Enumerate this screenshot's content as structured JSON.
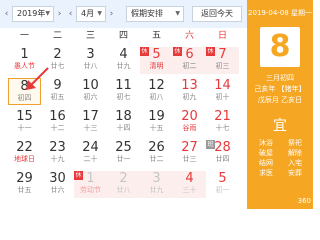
{
  "toolbar": {
    "year_value": "2019年",
    "month_value": "4月",
    "holiday_select": "假期安排",
    "today_button": "返回今天"
  },
  "weekdays": [
    "一",
    "二",
    "三",
    "四",
    "五",
    "六",
    "日"
  ],
  "weeks": [
    [
      {
        "day": "1",
        "lunar": "愚人节",
        "other": false,
        "weekend": false,
        "festival": true,
        "badge": "",
        "holiday": false
      },
      {
        "day": "2",
        "lunar": "廿七",
        "other": false,
        "weekend": false,
        "festival": false,
        "badge": "",
        "holiday": false
      },
      {
        "day": "3",
        "lunar": "廿八",
        "other": false,
        "weekend": false,
        "festival": false,
        "badge": "",
        "holiday": false
      },
      {
        "day": "4",
        "lunar": "廿九",
        "other": false,
        "weekend": false,
        "festival": false,
        "badge": "",
        "holiday": false
      },
      {
        "day": "5",
        "lunar": "清明",
        "other": false,
        "weekend": true,
        "festival": true,
        "badge": "休",
        "holiday": true
      },
      {
        "day": "6",
        "lunar": "初二",
        "other": false,
        "weekend": true,
        "festival": false,
        "badge": "休",
        "holiday": true
      },
      {
        "day": "7",
        "lunar": "初三",
        "other": false,
        "weekend": true,
        "festival": false,
        "badge": "休",
        "holiday": true
      }
    ],
    [
      {
        "day": "8",
        "lunar": "初四",
        "other": false,
        "weekend": false,
        "festival": false,
        "badge": "",
        "holiday": false,
        "today": true
      },
      {
        "day": "9",
        "lunar": "初五",
        "other": false,
        "weekend": false,
        "festival": false,
        "badge": "",
        "holiday": false
      },
      {
        "day": "10",
        "lunar": "初六",
        "other": false,
        "weekend": false,
        "festival": false,
        "badge": "",
        "holiday": false
      },
      {
        "day": "11",
        "lunar": "初七",
        "other": false,
        "weekend": false,
        "festival": false,
        "badge": "",
        "holiday": false
      },
      {
        "day": "12",
        "lunar": "初八",
        "other": false,
        "weekend": false,
        "festival": false,
        "badge": "",
        "holiday": false
      },
      {
        "day": "13",
        "lunar": "初九",
        "other": false,
        "weekend": true,
        "festival": false,
        "badge": "",
        "holiday": false
      },
      {
        "day": "14",
        "lunar": "初十",
        "other": false,
        "weekend": true,
        "festival": false,
        "badge": "",
        "holiday": false
      }
    ],
    [
      {
        "day": "15",
        "lunar": "十一",
        "other": false,
        "weekend": false,
        "festival": false,
        "badge": "",
        "holiday": false
      },
      {
        "day": "16",
        "lunar": "十二",
        "other": false,
        "weekend": false,
        "festival": false,
        "badge": "",
        "holiday": false
      },
      {
        "day": "17",
        "lunar": "十三",
        "other": false,
        "weekend": false,
        "festival": false,
        "badge": "",
        "holiday": false
      },
      {
        "day": "18",
        "lunar": "十四",
        "other": false,
        "weekend": false,
        "festival": false,
        "badge": "",
        "holiday": false
      },
      {
        "day": "19",
        "lunar": "十五",
        "other": false,
        "weekend": false,
        "festival": false,
        "badge": "",
        "holiday": false
      },
      {
        "day": "20",
        "lunar": "谷雨",
        "other": false,
        "weekend": true,
        "festival": true,
        "badge": "",
        "holiday": false
      },
      {
        "day": "21",
        "lunar": "十七",
        "other": false,
        "weekend": true,
        "festival": false,
        "badge": "",
        "holiday": false
      }
    ],
    [
      {
        "day": "22",
        "lunar": "地球日",
        "other": false,
        "weekend": false,
        "festival": true,
        "badge": "",
        "holiday": false
      },
      {
        "day": "23",
        "lunar": "十九",
        "other": false,
        "weekend": false,
        "festival": false,
        "badge": "",
        "holiday": false
      },
      {
        "day": "24",
        "lunar": "二十",
        "other": false,
        "weekend": false,
        "festival": false,
        "badge": "",
        "holiday": false
      },
      {
        "day": "25",
        "lunar": "廿一",
        "other": false,
        "weekend": false,
        "festival": false,
        "badge": "",
        "holiday": false
      },
      {
        "day": "26",
        "lunar": "廿二",
        "other": false,
        "weekend": false,
        "festival": false,
        "badge": "",
        "holiday": false
      },
      {
        "day": "27",
        "lunar": "廿三",
        "other": false,
        "weekend": true,
        "festival": false,
        "badge": "",
        "holiday": false
      },
      {
        "day": "28",
        "lunar": "廿四",
        "other": false,
        "weekend": true,
        "festival": false,
        "badge": "班",
        "holiday": false
      }
    ],
    [
      {
        "day": "29",
        "lunar": "廿五",
        "other": false,
        "weekend": false,
        "festival": false,
        "badge": "",
        "holiday": false
      },
      {
        "day": "30",
        "lunar": "廿六",
        "other": false,
        "weekend": false,
        "festival": false,
        "badge": "",
        "holiday": false
      },
      {
        "day": "1",
        "lunar": "劳动节",
        "other": true,
        "weekend": false,
        "festival": true,
        "badge": "休",
        "holiday": true
      },
      {
        "day": "2",
        "lunar": "廿八",
        "other": true,
        "weekend": false,
        "festival": false,
        "badge": "",
        "holiday": true
      },
      {
        "day": "3",
        "lunar": "廿九",
        "other": true,
        "weekend": false,
        "festival": false,
        "badge": "",
        "holiday": true
      },
      {
        "day": "4",
        "lunar": "三十",
        "other": true,
        "weekend": true,
        "festival": false,
        "badge": "",
        "holiday": true
      },
      {
        "day": "5",
        "lunar": "初一",
        "other": true,
        "weekend": true,
        "festival": false,
        "badge": "",
        "holiday": false
      }
    ]
  ],
  "side": {
    "date_line": "2019-04-08 星期一",
    "big_day": "8",
    "lunar_date": "三月初四",
    "ganzhi_year": "己亥年 【猪年】",
    "ganzhi_day": "戊辰月 乙亥日",
    "yi_label": "宜",
    "yi_items_left": [
      "沐浴",
      "破屋",
      "结网",
      "求医"
    ],
    "yi_items_right": [
      "祭祀",
      "解除",
      "入宅",
      "安葬"
    ],
    "watermark": "360"
  },
  "colors": {
    "accent": "#f5a623",
    "weekend_red": "#e8393a",
    "toolbar_bg": "#eaf3fd"
  }
}
